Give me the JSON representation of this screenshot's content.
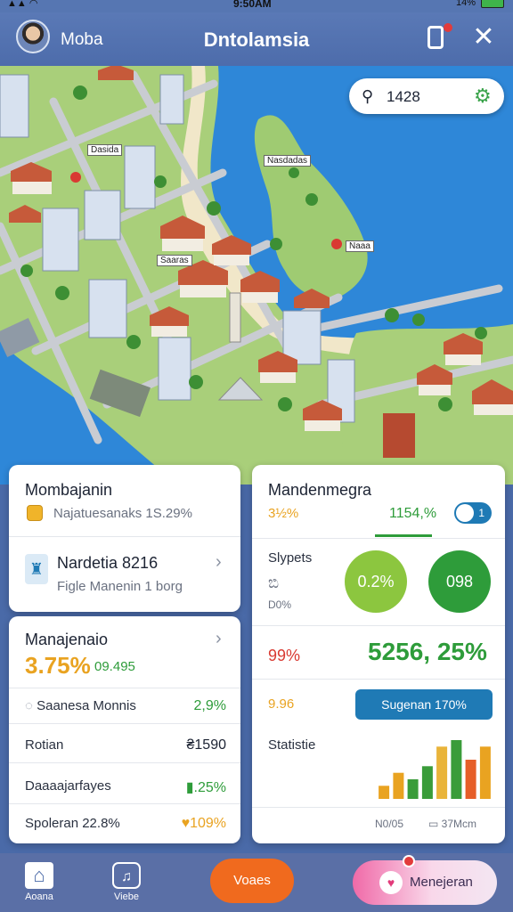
{
  "status": {
    "time": "9:50AM",
    "battery": "14%"
  },
  "header": {
    "username": "Moba",
    "title": "Dntolamsia"
  },
  "map": {
    "search_value": "1428",
    "labels": [
      "Dasida",
      "Nasdadas",
      "Saaras",
      "Naaa"
    ]
  },
  "card_left_top": {
    "title": "Mombajanin",
    "summary": "Najatuesanaks 1S.29%",
    "item_title": "Nardetia 8216",
    "item_sub": "Figle Manenin 1 borg"
  },
  "card_left_bottom": {
    "title": "Manajenaio",
    "big_value": "3.75%",
    "big_secondary": "09.495",
    "rows": [
      {
        "label": "Saanesa Monnis",
        "value": "2,9%",
        "color": "green"
      },
      {
        "label": "Rotian",
        "value": "₴1590",
        "color": "dark"
      },
      {
        "label": "Daaaajarfayes",
        "value": "▮.25%",
        "color": "green"
      },
      {
        "label": "Spoleran 22.8%",
        "value": "♥109%",
        "color": "orange"
      }
    ]
  },
  "card_right": {
    "title": "Mandenmegra",
    "ratio_left": "3½%",
    "ratio_right": "1154,%",
    "toggle_label": "1",
    "subtitle": "Slypets",
    "icon_note": "ಬಿ",
    "note": "D0%",
    "circle_left": "0.2%",
    "circle_right": "098",
    "red_value": "99%",
    "big_value": "5256, 25%",
    "orange_value": "9.96",
    "suggest_button": "Sugenan 170%",
    "stats_title": "Statistie",
    "chart_footer_left": "N0/05",
    "chart_footer_right": "37Mcm",
    "bars": [
      {
        "value": 2,
        "color": "#e9a321"
      },
      {
        "value": 4,
        "color": "#e9a321"
      },
      {
        "value": 3,
        "color": "#3a9c3a"
      },
      {
        "value": 5,
        "color": "#3a9c3a"
      },
      {
        "value": 8,
        "color": "#e9b43a"
      },
      {
        "value": 9,
        "color": "#3a9c3a"
      },
      {
        "value": 6,
        "color": "#e65e28"
      },
      {
        "value": 8,
        "color": "#e9a321"
      }
    ]
  },
  "bottom_nav": {
    "home_label": "Aoana",
    "chart_label": "Viebe",
    "orange_button": "Voaes",
    "pink_button": "Menejeran"
  }
}
